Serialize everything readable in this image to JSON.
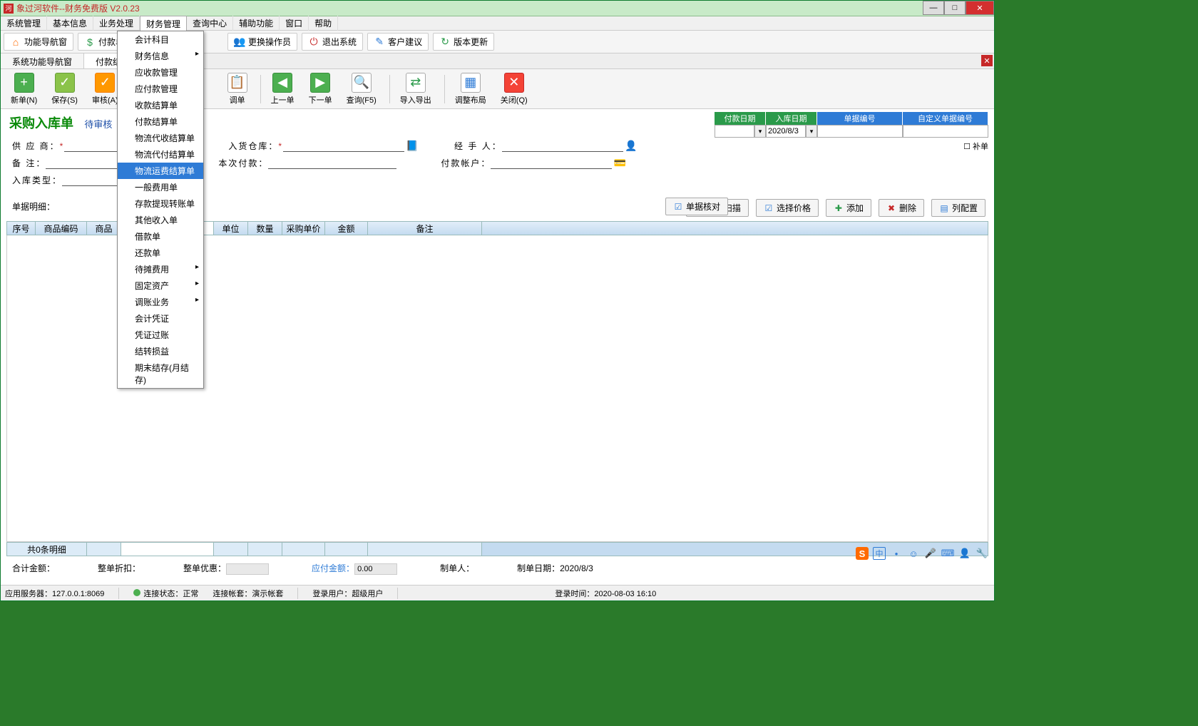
{
  "titlebar": {
    "text": "象过河软件--财务免费版 V2.0.23"
  },
  "menubar": {
    "items": [
      "系统管理",
      "基本信息",
      "业务处理",
      "财务管理",
      "查询中心",
      "辅助功能",
      "窗口",
      "帮助"
    ]
  },
  "toolbar1": {
    "btn1": "功能导航窗",
    "btn2": "付款单",
    "btn3": "更换操作员",
    "btn4": "退出系统",
    "btn5": "客户建议",
    "btn6": "版本更新"
  },
  "tabs": {
    "t1": "系统功能导航窗",
    "t2": "付款结算单"
  },
  "toolbar2": {
    "b1": "新单(N)",
    "b2": "保存(S)",
    "b3": "审核(A)",
    "b4": "调单",
    "b5": "上一单",
    "b6": "下一单",
    "b7": "查询(F5)",
    "b8": "导入导出",
    "b9": "调整布局",
    "b10": "关闭(Q)"
  },
  "dropdown": [
    {
      "label": "会计科目",
      "arrow": false
    },
    {
      "label": "财务信息",
      "arrow": true
    },
    {
      "label": "应收款管理",
      "arrow": false
    },
    {
      "label": "应付款管理",
      "arrow": false
    },
    {
      "label": "收款结算单",
      "arrow": false
    },
    {
      "label": "付款结算单",
      "arrow": false
    },
    {
      "label": "物流代收结算单",
      "arrow": false
    },
    {
      "label": "物流代付结算单",
      "arrow": false
    },
    {
      "label": "物流运费结算单",
      "arrow": false
    },
    {
      "label": "一般费用单",
      "arrow": false
    },
    {
      "label": "存款提现转账单",
      "arrow": false
    },
    {
      "label": "其他收入单",
      "arrow": false
    },
    {
      "label": "借款单",
      "arrow": false
    },
    {
      "label": "还款单",
      "arrow": false
    },
    {
      "label": "待摊费用",
      "arrow": true
    },
    {
      "label": "固定资产",
      "arrow": true
    },
    {
      "label": "调账业务",
      "arrow": true
    },
    {
      "label": "会计凭证",
      "arrow": false
    },
    {
      "label": "凭证过账",
      "arrow": false
    },
    {
      "label": "结转损益",
      "arrow": false
    },
    {
      "label": "期末结存(月结存)",
      "arrow": false
    }
  ],
  "doc": {
    "title": "采购入库单",
    "status": "待审核"
  },
  "headerstrip": {
    "c1": "付款日期",
    "c2": "入库日期",
    "c3": "单据编号",
    "c4": "自定义单据编号",
    "date": "2020/8/3",
    "supp": "☐ 补单"
  },
  "form": {
    "supplier_label": "供 应 商：",
    "remark_label": "备    注：",
    "intype_label": "入库类型：",
    "detail_label": "单据明细：",
    "warehouse_label": "入货仓库：",
    "thispay_label": "本次付款：",
    "handler_label": "经 手 人：",
    "account_label": "付款帐户："
  },
  "actions": {
    "mid": "单据核对",
    "scan": "条码扫描",
    "price": "选择价格",
    "add": "添加",
    "del": "删除",
    "col": "列配置"
  },
  "grid": {
    "h1": "序号",
    "h2": "商品编码",
    "h3": "商品",
    "h4": "单位",
    "h5": "数量",
    "h6": "采购单价",
    "h7": "金额",
    "h8": "备注",
    "footer": "共0条明细"
  },
  "totals": {
    "total_label": "合计金额：",
    "discount_label": "整单折扣：",
    "pref_label": "整单优惠：",
    "pay_label": "应付金额：",
    "pay_val": "0.00",
    "maker_label": "制单人：",
    "makedate_label": "制单日期：",
    "makedate_val": "2020/8/3"
  },
  "status": {
    "server_label": "应用服务器：",
    "server_val": "127.0.0.1:8069",
    "conn_label": "连接状态：",
    "conn_val": "正常",
    "acct_label": "连接帐套：演示帐套",
    "user_label": "登录用户：",
    "user_val": "超级用户",
    "time_label": "登录时间：",
    "time_val": "2020-08-03 16:10"
  },
  "ime": {
    "zhong": "中"
  }
}
